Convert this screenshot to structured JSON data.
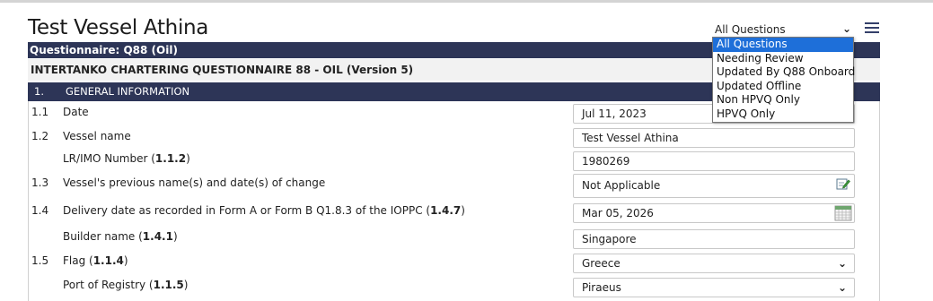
{
  "page": {
    "title": "Test Vessel Athina"
  },
  "filter": {
    "selected": "All Questions",
    "options": [
      "All Questions",
      "Needing Review",
      "Updated By Q88 Onboard",
      "Updated Offline",
      "Non HPVQ Only",
      "HPVQ Only"
    ]
  },
  "questionnaire": {
    "label": "Questionnaire: Q88 (Oil)",
    "subheading": "INTERTANKO CHARTERING QUESTIONNAIRE 88 - OIL (Version 5)"
  },
  "section": {
    "number": "1.",
    "title": "GENERAL INFORMATION"
  },
  "rows": [
    {
      "num": "1.1",
      "label": "Date",
      "ref": "",
      "value": "Jul 11, 2023"
    },
    {
      "num": "1.2",
      "label": "Vessel name",
      "ref": "",
      "value": "Test Vessel Athina"
    },
    {
      "num": "",
      "label": "LR/IMO Number (",
      "ref": "1.1.2",
      "value": "1980269"
    },
    {
      "num": "1.3",
      "label": "Vessel's previous name(s) and date(s) of change",
      "ref": "",
      "value": "Not Applicable"
    },
    {
      "num": "1.4",
      "label": "Delivery date as recorded in Form A or Form B Q1.8.3 of the IOPPC (",
      "ref": "1.4.7",
      "value": "Mar 05, 2026"
    },
    {
      "num": "",
      "label": "Builder name (",
      "ref": "1.4.1",
      "value": "Singapore"
    },
    {
      "num": "1.5",
      "label": "Flag (",
      "ref": "1.1.4",
      "value": "Greece"
    },
    {
      "num": "",
      "label": "Port of Registry (",
      "ref": "1.1.5",
      "value": "Piraeus"
    }
  ],
  "icons": {
    "menu": "hamburger-icon",
    "edit": "edit-note-icon",
    "calendar": "calendar-icon",
    "chevron": "chevron-down-icon"
  },
  "colors": {
    "header_bar": "#2d3557",
    "selected_option": "#1e6fd9"
  }
}
